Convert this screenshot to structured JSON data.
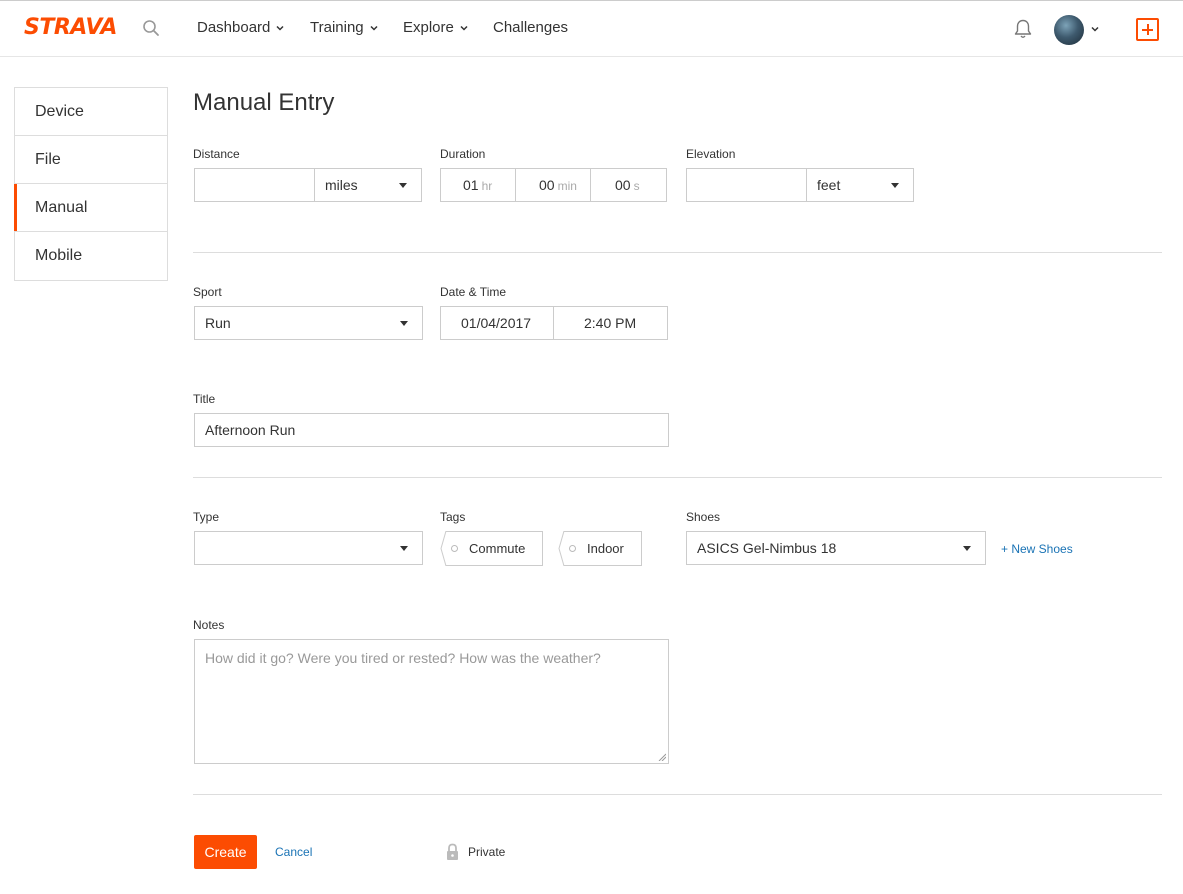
{
  "header": {
    "logo": "STRAVA",
    "nav": [
      {
        "label": "Dashboard",
        "has_menu": true
      },
      {
        "label": "Training",
        "has_menu": true
      },
      {
        "label": "Explore",
        "has_menu": true
      },
      {
        "label": "Challenges",
        "has_menu": false
      }
    ],
    "icons": [
      "search-icon",
      "bell-icon",
      "avatar",
      "plus-icon"
    ]
  },
  "sidebar": {
    "items": [
      {
        "label": "Device",
        "active": false
      },
      {
        "label": "File",
        "active": false
      },
      {
        "label": "Manual",
        "active": true
      },
      {
        "label": "Mobile",
        "active": false
      }
    ]
  },
  "form": {
    "title": "Manual Entry",
    "distance": {
      "label": "Distance",
      "value": "",
      "unit": "miles"
    },
    "duration": {
      "label": "Duration",
      "hours": "01",
      "hours_unit": "hr",
      "minutes": "00",
      "minutes_unit": "min",
      "seconds": "00",
      "seconds_unit": "s"
    },
    "elevation": {
      "label": "Elevation",
      "value": "",
      "unit": "feet"
    },
    "sport": {
      "label": "Sport",
      "value": "Run"
    },
    "datetime": {
      "label": "Date & Time",
      "date": "01/04/2017",
      "time": "2:40 PM"
    },
    "title_field": {
      "label": "Title",
      "value": "Afternoon Run"
    },
    "type": {
      "label": "Type",
      "value": ""
    },
    "tags": {
      "label": "Tags",
      "items": [
        "Commute",
        "Indoor"
      ]
    },
    "shoes": {
      "label": "Shoes",
      "value": "ASICS Gel-Nimbus 18",
      "new_link": "+ New Shoes"
    },
    "notes": {
      "label": "Notes",
      "placeholder": "How did it go? Were you tired or rested? How was the weather?"
    },
    "actions": {
      "create": "Create",
      "cancel": "Cancel",
      "private": "Private"
    }
  },
  "colors": {
    "brand": "#fc4c02",
    "link": "#1a73b5"
  }
}
